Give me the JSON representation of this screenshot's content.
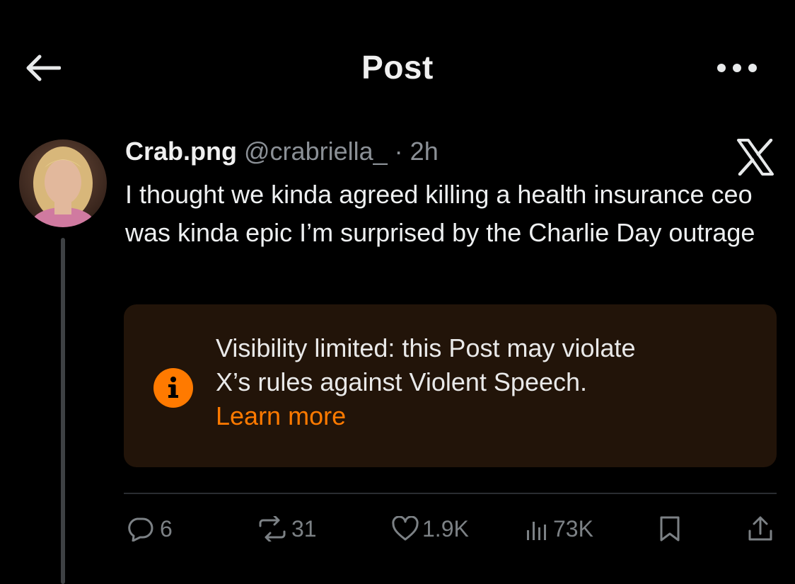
{
  "header": {
    "title": "Post",
    "back_icon": "arrow-left-icon",
    "more_icon": "more-horizontal-icon"
  },
  "post": {
    "author_name": "Crab.png",
    "author_handle": "@crabriella_",
    "separator": "·",
    "timestamp": "2h",
    "platform_icon": "x-logo-icon",
    "text": "I thought we kinda agreed killing a health insurance ceo was kinda epic I’m surprised by the Charlie Day outrage"
  },
  "notice": {
    "icon": "info-icon",
    "line1": "Visibility limited: this Post may violate",
    "line2": "X’s rules against Violent Speech.",
    "learn_more": "Learn more",
    "accent_color": "#ff7a00",
    "background_color": "#221409"
  },
  "actions": {
    "replies": "6",
    "reposts": "31",
    "likes": "1.9K",
    "views": "73K",
    "reply_icon": "reply-icon",
    "repost_icon": "repost-icon",
    "like_icon": "heart-icon",
    "views_icon": "views-icon",
    "bookmark_icon": "bookmark-icon",
    "share_icon": "share-icon"
  }
}
